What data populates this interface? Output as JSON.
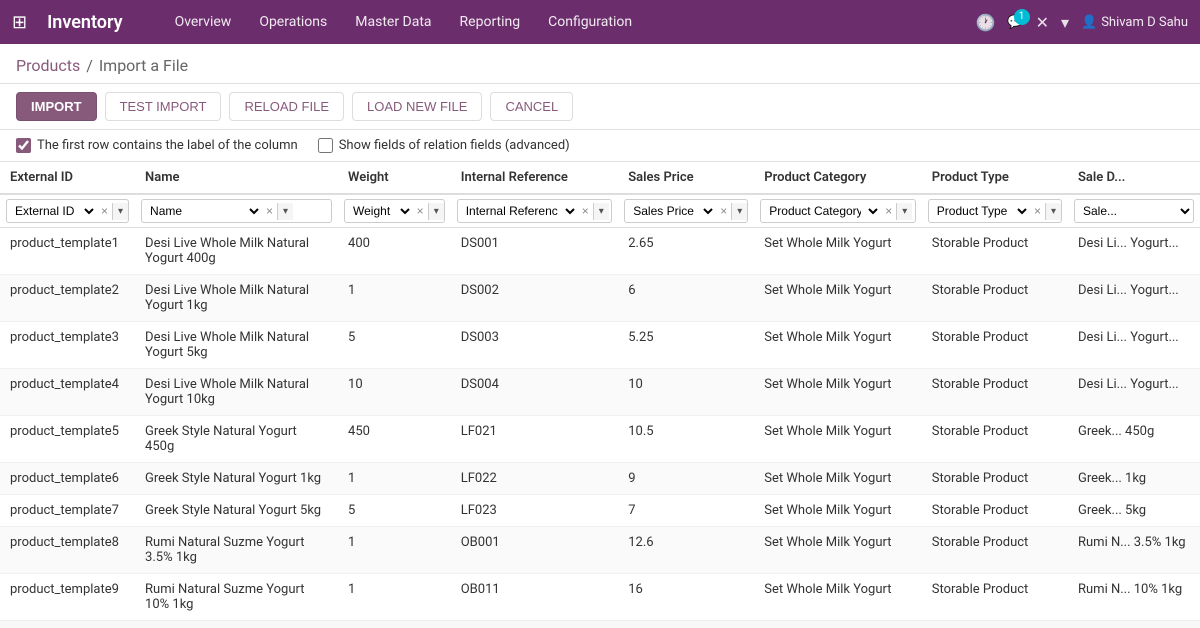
{
  "topnav": {
    "app_name": "Inventory",
    "menu_items": [
      "Overview",
      "Operations",
      "Master Data",
      "Reporting",
      "Configuration"
    ],
    "notification_count": "1",
    "user_name": "Shivam D Sahu"
  },
  "breadcrumb": {
    "parent_label": "Products",
    "separator": "/",
    "current_label": "Import a File"
  },
  "toolbar": {
    "import_label": "IMPORT",
    "test_import_label": "TEST IMPORT",
    "reload_file_label": "RELOAD FILE",
    "load_new_file_label": "LOAD NEW FILE",
    "cancel_label": "CANCEL"
  },
  "options": {
    "first_row_label": "The first row contains the label of the column",
    "show_fields_label": "Show fields of relation fields (advanced)"
  },
  "table": {
    "columns": [
      "External ID",
      "Name",
      "Weight",
      "Internal Reference",
      "Sales Price",
      "Product Category",
      "Product Type",
      "Sale D..."
    ],
    "filters": [
      {
        "value": "External ID",
        "clearable": true
      },
      {
        "value": "Name",
        "clearable": true
      },
      {
        "value": "Weight",
        "clearable": true
      },
      {
        "value": "Internal Reference",
        "clearable": true
      },
      {
        "value": "Sales Price",
        "clearable": true
      },
      {
        "value": "Product Category",
        "clearable": true
      },
      {
        "value": "Product Type",
        "clearable": true
      },
      {
        "value": "Sale...",
        "clearable": false
      }
    ],
    "rows": [
      {
        "external_id": "product_template1",
        "name": "Desi Live Whole Milk Natural Yogurt 400g",
        "weight": "400",
        "internal_ref": "DS001",
        "sales_price": "2.65",
        "product_category": "Set Whole Milk Yogurt",
        "product_type": "Storable Product",
        "sale_desc": "Desi Li... Yogurt..."
      },
      {
        "external_id": "product_template2",
        "name": "Desi Live Whole Milk Natural Yogurt 1kg",
        "weight": "1",
        "internal_ref": "DS002",
        "sales_price": "6",
        "product_category": "Set Whole Milk Yogurt",
        "product_type": "Storable Product",
        "sale_desc": "Desi Li... Yogurt..."
      },
      {
        "external_id": "product_template3",
        "name": "Desi Live Whole Milk Natural Yogurt 5kg",
        "weight": "5",
        "internal_ref": "DS003",
        "sales_price": "5.25",
        "product_category": "Set Whole Milk Yogurt",
        "product_type": "Storable Product",
        "sale_desc": "Desi Li... Yogurt..."
      },
      {
        "external_id": "product_template4",
        "name": "Desi Live Whole Milk Natural Yogurt 10kg",
        "weight": "10",
        "internal_ref": "DS004",
        "sales_price": "10",
        "product_category": "Set Whole Milk Yogurt",
        "product_type": "Storable Product",
        "sale_desc": "Desi Li... Yogurt..."
      },
      {
        "external_id": "product_template5",
        "name": "Greek Style Natural Yogurt 450g",
        "weight": "450",
        "internal_ref": "LF021",
        "sales_price": "10.5",
        "product_category": "Set Whole Milk Yogurt",
        "product_type": "Storable Product",
        "sale_desc": "Greek... 450g"
      },
      {
        "external_id": "product_template6",
        "name": "Greek Style Natural Yogurt 1kg",
        "weight": "1",
        "internal_ref": "LF022",
        "sales_price": "9",
        "product_category": "Set Whole Milk Yogurt",
        "product_type": "Storable Product",
        "sale_desc": "Greek... 1kg"
      },
      {
        "external_id": "product_template7",
        "name": "Greek Style Natural Yogurt 5kg",
        "weight": "5",
        "internal_ref": "LF023",
        "sales_price": "7",
        "product_category": "Set Whole Milk Yogurt",
        "product_type": "Storable Product",
        "sale_desc": "Greek... 5kg"
      },
      {
        "external_id": "product_template8",
        "name": "Rumi Natural Suzme Yogurt 3.5% 1kg",
        "weight": "1",
        "internal_ref": "OB001",
        "sales_price": "12.6",
        "product_category": "Set Whole Milk Yogurt",
        "product_type": "Storable Product",
        "sale_desc": "Rumi N... 3.5% 1kg"
      },
      {
        "external_id": "product_template9",
        "name": "Rumi Natural Suzme Yogurt 10% 1kg",
        "weight": "1",
        "internal_ref": "OB011",
        "sales_price": "16",
        "product_category": "Set Whole Milk Yogurt",
        "product_type": "Storable Product",
        "sale_desc": "Rumi N... 10% 1kg"
      }
    ]
  }
}
